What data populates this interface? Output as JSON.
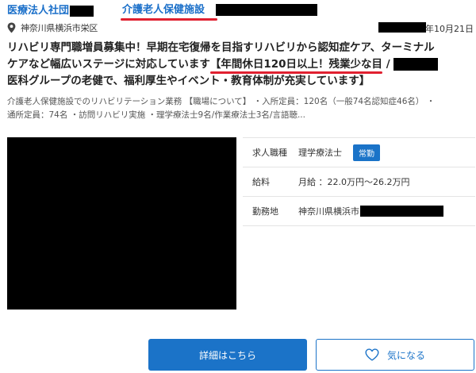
{
  "header": {
    "org_name": "医療法人社団",
    "facility_type": "介護老人保健施設"
  },
  "location": {
    "icon": "map-pin-icon",
    "address": "神奈川県横浜市栄区",
    "date_suffix": "年10月21日"
  },
  "title": {
    "line1": "リハビリ専門職増員募集中！早期在宅復帰を目指すリハビリから認知症ケア、ターミナル",
    "line2_prefix": "ケアなど幅広いステージに対応しています",
    "line2_highlight": "【年間休日120日以上！残業少な目",
    "line2_sep": " /",
    "line3": "医科グループの老健で、福利厚生やイベント・教育体制が充実しています】"
  },
  "description": {
    "line1": "介護老人保健施設でのリハビリテーション業務 【職場について】 ・入所定員：120名（一般74名認知症46名） ・",
    "line2": "通所定員：74名 ・訪問リハビリ実施 ・理学療法士9名/作業療法士3名/言語聴..."
  },
  "info": {
    "job_type_label": "求人職種",
    "job_type_value": "理学療法士",
    "employment_badge": "常勤",
    "salary_label": "給料",
    "salary_value": "月給 ：22.0万円〜26.2万円",
    "workplace_label": "勤務地",
    "workplace_value": "神奈川県横浜市"
  },
  "buttons": {
    "detail_label": "詳細はこちら",
    "favorite_label": "気になる",
    "favorite_icon": "heart-icon"
  },
  "colors": {
    "accent_blue": "#1a6fc9",
    "highlight_red": "#e02030",
    "button_blue": "#1b73c8"
  }
}
